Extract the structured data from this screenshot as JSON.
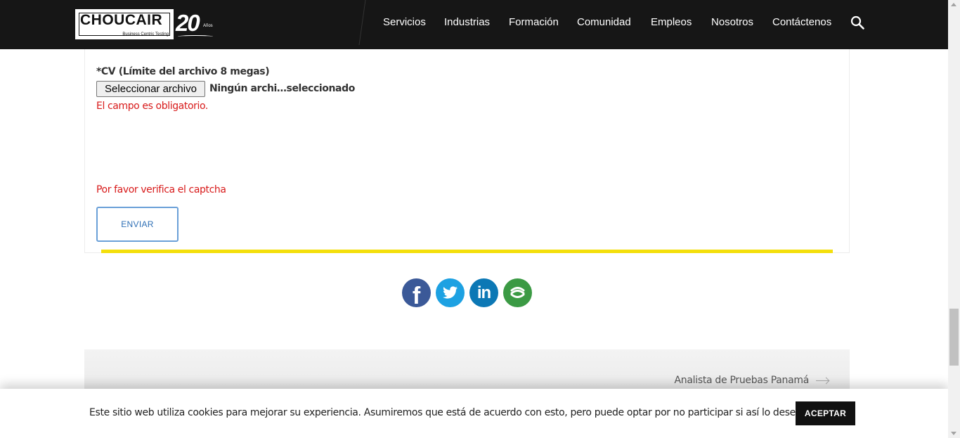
{
  "header": {
    "logo_text": "CHOUCAIR",
    "logo_subtitle": "Business Centric Testing",
    "logo_anniversary": "20",
    "logo_years": "Años",
    "nav": [
      {
        "label": "Servicios"
      },
      {
        "label": "Industrias"
      },
      {
        "label": "Formación"
      },
      {
        "label": "Comunidad"
      },
      {
        "label": "Empleos"
      },
      {
        "label": "Nosotros"
      },
      {
        "label": "Contáctenos"
      }
    ],
    "search_icon": "search-icon"
  },
  "form": {
    "cv_label": "*CV (Límite del archivo 8 megas)",
    "file_button_label": "Seleccionar archivo",
    "file_status": "Ningún archi…seleccionado",
    "cv_error": "El campo es obligatorio.",
    "captcha_error": "Por favor verifica el captcha",
    "submit_label": "ENVIAR",
    "error_color": "#d81a1a",
    "accent_line_color": "#f4df0c"
  },
  "social": [
    {
      "name": "facebook",
      "glyph": "f",
      "color": "#3b5998"
    },
    {
      "name": "twitter",
      "color": "#1da1e2"
    },
    {
      "name": "linkedin",
      "glyph": "in",
      "color": "#0c78b5"
    },
    {
      "name": "more",
      "color": "#3b9a44"
    }
  ],
  "post_nav": {
    "next_label": "Analista de Pruebas Panamá"
  },
  "cookie": {
    "text": "Este sitio web utiliza cookies para mejorar su experiencia. Asumiremos que está de acuerdo con esto, pero puede optar por no participar si así lo desea.",
    "accept_label": "ACEPTAR"
  }
}
